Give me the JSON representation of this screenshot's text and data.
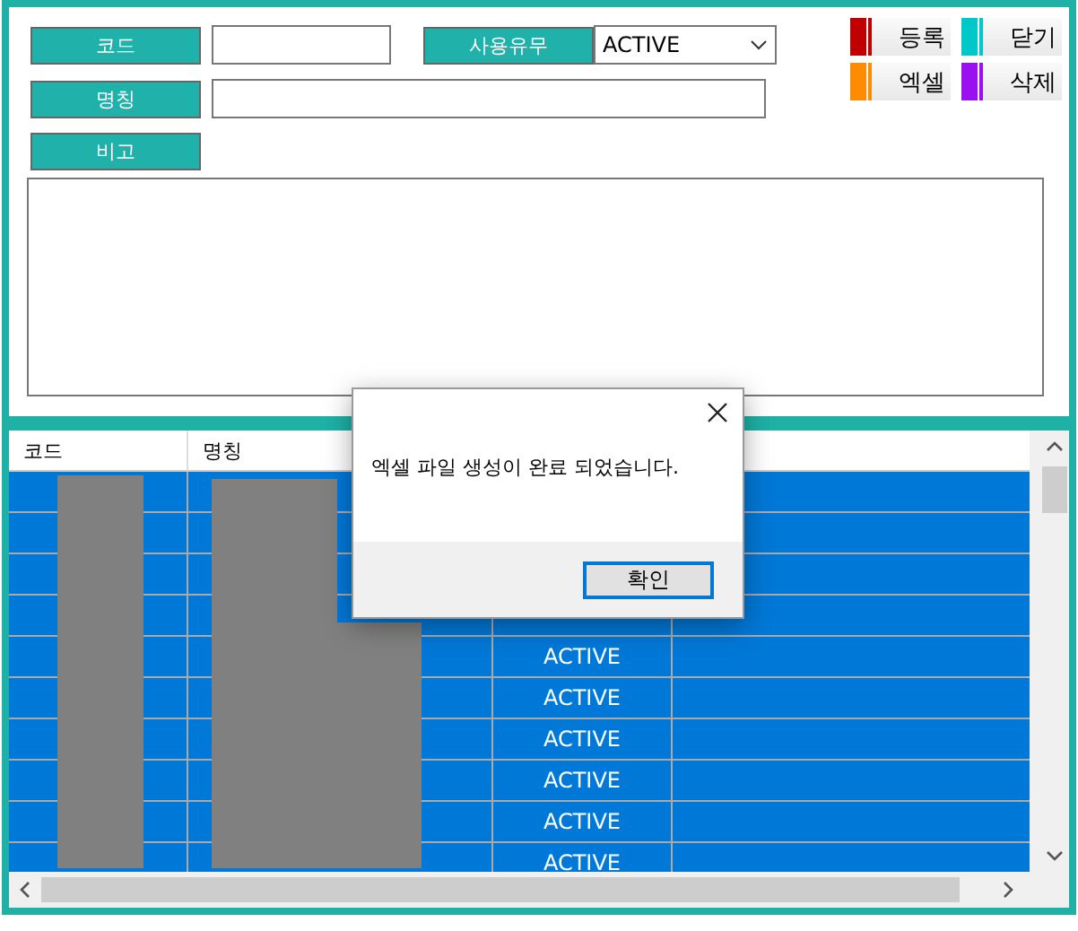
{
  "form": {
    "code_label": "코드",
    "use_label": "사용유무",
    "use_value": "ACTIVE",
    "name_label": "명칭",
    "note_label": "비고"
  },
  "actions": [
    {
      "label": "등록",
      "color": "#c00000"
    },
    {
      "label": "닫기",
      "color": "#00c8c8"
    },
    {
      "label": "엑셀",
      "color": "#ff8c00"
    },
    {
      "label": "삭제",
      "color": "#9b10f0"
    }
  ],
  "table": {
    "columns": [
      "코드",
      "명칭"
    ],
    "rows": [
      {
        "selected": true
      },
      {
        "selected": true
      },
      {
        "selected": true
      },
      {
        "selected": true
      },
      {
        "selected": true,
        "status": "ACTIVE"
      },
      {
        "selected": true,
        "status": "ACTIVE"
      },
      {
        "selected": true,
        "status": "ACTIVE"
      },
      {
        "selected": true,
        "status": "ACTIVE"
      },
      {
        "selected": true,
        "status": "ACTIVE"
      },
      {
        "selected": true,
        "status": "ACTIVE"
      }
    ]
  },
  "dialog": {
    "message": "엑셀 파일 생성이 완료 되었습니다.",
    "button": "확인"
  }
}
